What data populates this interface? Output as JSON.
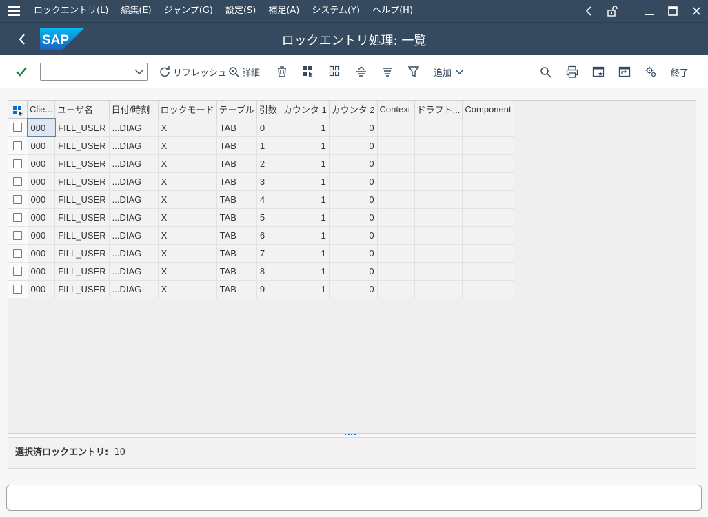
{
  "menu": {
    "items": [
      "ロックエントリ(L)",
      "編集(E)",
      "ジャンプ(G)",
      "設定(S)",
      "補足(A)",
      "システム(Y)",
      "ヘルプ(H)"
    ]
  },
  "window": {
    "title": "ロックエントリ処理: 一覧",
    "logo_text": "SAP"
  },
  "toolbar": {
    "command_value": "",
    "refresh_label": "リフレッシュ",
    "details_label": "詳細",
    "add_label": "追加",
    "exit_label": "終了"
  },
  "table": {
    "columns": [
      "Clie...",
      "ユーザ名",
      "日付/時刻",
      "ロックモード",
      "テーブル",
      "引数",
      "カウンタ 1",
      "カウンタ 2",
      "Context",
      "ドラフト...",
      "Component"
    ],
    "rows": [
      [
        "000",
        "FILL_USER",
        "...DIAG",
        "X",
        "TAB",
        "0",
        "1",
        "0",
        "",
        "",
        ""
      ],
      [
        "000",
        "FILL_USER",
        "...DIAG",
        "X",
        "TAB",
        "1",
        "1",
        "0",
        "",
        "",
        ""
      ],
      [
        "000",
        "FILL_USER",
        "...DIAG",
        "X",
        "TAB",
        "2",
        "1",
        "0",
        "",
        "",
        ""
      ],
      [
        "000",
        "FILL_USER",
        "...DIAG",
        "X",
        "TAB",
        "3",
        "1",
        "0",
        "",
        "",
        ""
      ],
      [
        "000",
        "FILL_USER",
        "...DIAG",
        "X",
        "TAB",
        "4",
        "1",
        "0",
        "",
        "",
        ""
      ],
      [
        "000",
        "FILL_USER",
        "...DIAG",
        "X",
        "TAB",
        "5",
        "1",
        "0",
        "",
        "",
        ""
      ],
      [
        "000",
        "FILL_USER",
        "...DIAG",
        "X",
        "TAB",
        "6",
        "1",
        "0",
        "",
        "",
        ""
      ],
      [
        "000",
        "FILL_USER",
        "...DIAG",
        "X",
        "TAB",
        "7",
        "1",
        "0",
        "",
        "",
        ""
      ],
      [
        "000",
        "FILL_USER",
        "...DIAG",
        "X",
        "TAB",
        "8",
        "1",
        "0",
        "",
        "",
        ""
      ],
      [
        "000",
        "FILL_USER",
        "...DIAG",
        "X",
        "TAB",
        "9",
        "1",
        "0",
        "",
        "",
        ""
      ]
    ]
  },
  "info": {
    "label": "選択済ロックエントリ:",
    "count": "10"
  },
  "colors": {
    "shell": "#354a5f",
    "accent": "#0a6ed1",
    "check": "#107e3e"
  }
}
